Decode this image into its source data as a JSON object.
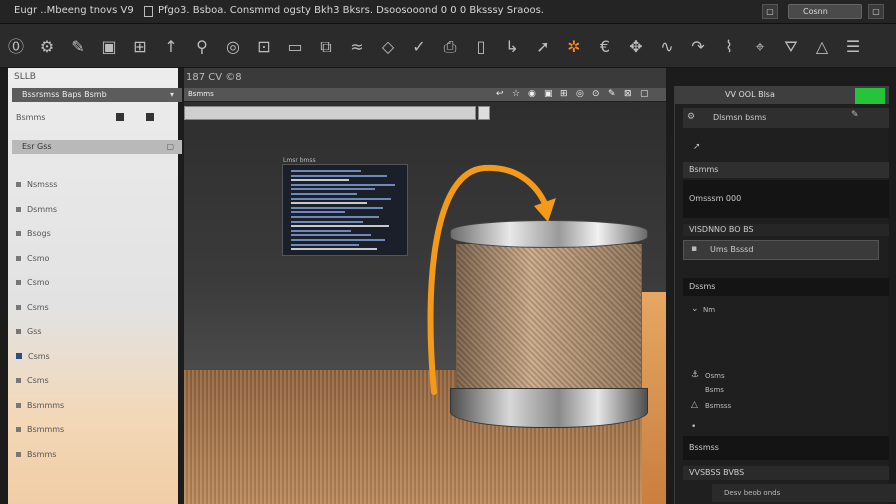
{
  "titlebar": {
    "app_title": "Eugr ..Mbeeng tnovs V9",
    "doc_title": "Pfgo3. Bsboa. Consmmd ogsty Bkh3 Bksrs. Dsoosooond 0 0 0 Bksssy Sraoos.",
    "search_label": "Cosnn",
    "btn_left": "▢",
    "btn_right": "▢"
  },
  "toolbar": {
    "icons": [
      {
        "name": "zero-icon",
        "glyph": "⓪"
      },
      {
        "name": "gear-icon",
        "glyph": "⚙"
      },
      {
        "name": "pen-icon",
        "glyph": "✎"
      },
      {
        "name": "frame-icon",
        "glyph": "▣"
      },
      {
        "name": "grid-icon",
        "glyph": "⊞"
      },
      {
        "name": "arrow-up-icon",
        "glyph": "↑"
      },
      {
        "name": "link-icon",
        "glyph": "⚲"
      },
      {
        "name": "ring-icon",
        "glyph": "◎"
      },
      {
        "name": "camera-icon",
        "glyph": "⊡"
      },
      {
        "name": "box-icon",
        "glyph": "▭"
      },
      {
        "name": "layers-icon",
        "glyph": "⧉"
      },
      {
        "name": "wave-icon",
        "glyph": "≈"
      },
      {
        "name": "diamond-icon",
        "glyph": "◇"
      },
      {
        "name": "check-icon",
        "glyph": "✓"
      },
      {
        "name": "printer-icon",
        "glyph": "⎙"
      },
      {
        "name": "page-icon",
        "glyph": "▯"
      },
      {
        "name": "hook-icon",
        "glyph": "↳"
      },
      {
        "name": "cursor-icon",
        "glyph": "➚"
      },
      {
        "name": "spark-icon",
        "glyph": "✲"
      },
      {
        "name": "euro-icon",
        "glyph": "€"
      },
      {
        "name": "move-icon",
        "glyph": "✥"
      },
      {
        "name": "curve-icon",
        "glyph": "∿"
      },
      {
        "name": "redo-icon",
        "glyph": "↷"
      },
      {
        "name": "filter-icon",
        "glyph": "⌇"
      },
      {
        "name": "pin-icon",
        "glyph": "⌖"
      },
      {
        "name": "bucket-icon",
        "glyph": "⛛"
      },
      {
        "name": "triangle-icon",
        "glyph": "△"
      },
      {
        "name": "stack-icon",
        "glyph": "☰"
      }
    ]
  },
  "left_panel": {
    "title": "SLLB",
    "header1": "Bssrsmss Baps Bsmb",
    "item_main": "Bsmms",
    "header2": "Esr Gss",
    "rows": [
      "Nsmsss",
      "Dsmms",
      "Bsogs",
      "Csmo",
      "Csmo",
      "Csms",
      "Gss",
      "Csms",
      "Csms",
      "Bsmmms",
      "Bsmmms",
      "Bsmms"
    ]
  },
  "center": {
    "title": "187 CV ©8",
    "tab_label": "Bsmms",
    "code_title": "Lmsr bmss",
    "tab_icons": [
      "↩",
      "☆",
      "◉",
      "▣",
      "⊞",
      "◎",
      "⊙",
      "✎",
      "⊠",
      "▢"
    ]
  },
  "right_panel": {
    "header": "VV OOL Blsa",
    "row1": "Dlsmsn bsms",
    "sec_a": "Bsmms",
    "sec_b": "Omsssm 000",
    "sec_c": "VISDNNO BO BS",
    "dropdown": "Ums Bsssd",
    "sec_d": "Dssms",
    "lbl1": "Nm",
    "lbl2": "Osms",
    "lbl3": "Bsms",
    "lbl4": "Bsmsss",
    "sec_e": "Bssmss",
    "sec_f": "VVSBSS BVBS",
    "footer": "Desv beob onds"
  }
}
